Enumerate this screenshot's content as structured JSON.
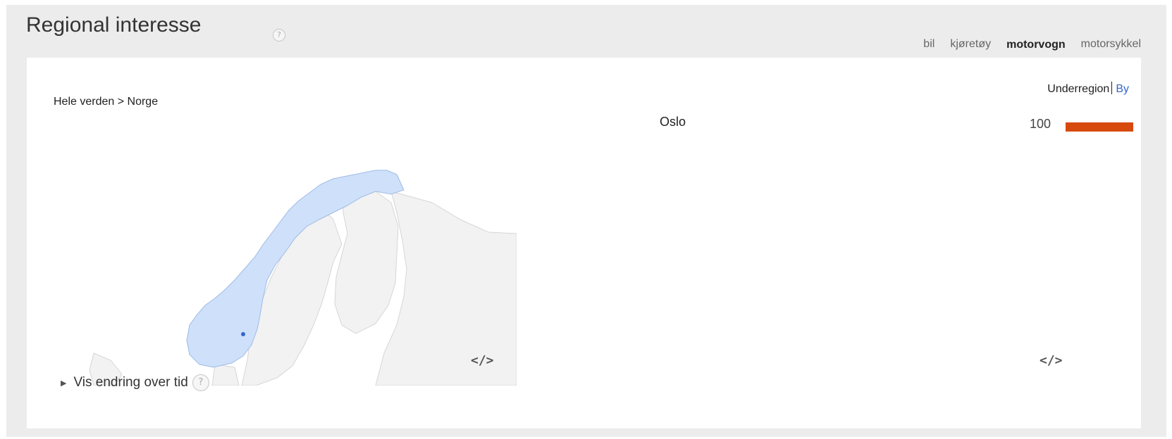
{
  "header": {
    "title": "Regional interesse",
    "help_glyph": "?"
  },
  "tabs": [
    {
      "label": "bil",
      "active": false
    },
    {
      "label": "kjøretøy",
      "active": false
    },
    {
      "label": "motorvogn",
      "active": true
    },
    {
      "label": "motorsykkel",
      "active": false
    }
  ],
  "map_section": {
    "breadcrumb": "Hele verden > Norge",
    "vis_endring_label": "Vis endring over tid",
    "embed_label": "</>"
  },
  "list_section": {
    "toggle": {
      "subregion": "Underregion",
      "city": "By"
    },
    "rows": [
      {
        "name": "Oslo",
        "value": "100",
        "fill": 1.0
      }
    ],
    "embed_label": "</>"
  },
  "colors": {
    "tab_active_underline": "#f0a31c",
    "bar": "#d64a0e",
    "link": "#3366cc",
    "norway_fill": "#cfe0fa",
    "land_fill": "#f2f2f2"
  },
  "icons": {
    "help": "question-circle-icon",
    "expand": "triangle-right-icon",
    "embed": "code-embed-icon"
  }
}
